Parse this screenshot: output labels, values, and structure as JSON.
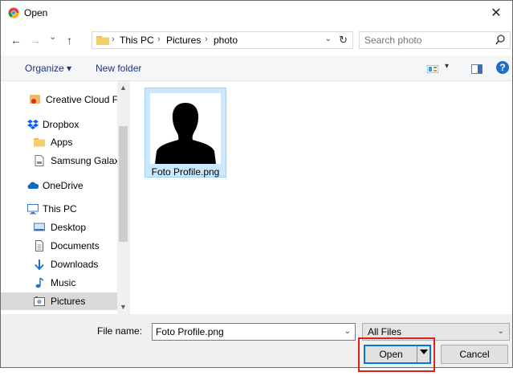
{
  "window": {
    "title": "Open",
    "close_glyph": "✕"
  },
  "nav": {
    "back": "←",
    "forward": "→",
    "recent": "⌄",
    "up": "↑",
    "breadcrumb": [
      "This PC",
      "Pictures",
      "photo"
    ],
    "separator": "›",
    "address_dropdown": "⌄",
    "refresh": "↻",
    "search_placeholder": "Search photo"
  },
  "toolbar": {
    "organize": "Organize ▾",
    "new_folder": "New folder",
    "view_dropdown": "▾",
    "help": "?"
  },
  "sidebar": {
    "items": [
      {
        "label": "Creative Cloud Fil",
        "icon": "creative-cloud-icon"
      },
      {
        "label": "Dropbox",
        "icon": "dropbox-icon"
      },
      {
        "label": "Apps",
        "icon": "folder-icon"
      },
      {
        "label": "Samsung Galaxy",
        "icon": "file-icon"
      },
      {
        "label": "OneDrive",
        "icon": "onedrive-icon"
      },
      {
        "label": "This PC",
        "icon": "computer-icon"
      },
      {
        "label": "Desktop",
        "icon": "desktop-icon"
      },
      {
        "label": "Documents",
        "icon": "documents-icon"
      },
      {
        "label": "Downloads",
        "icon": "downloads-icon"
      },
      {
        "label": "Music",
        "icon": "music-icon"
      },
      {
        "label": "Pictures",
        "icon": "pictures-icon",
        "selected": true
      }
    ],
    "scroll_up": "▲",
    "scroll_down": "▼"
  },
  "files": [
    {
      "name": "Foto Profile.png",
      "icon": "person-silhouette-icon",
      "selected": true
    }
  ],
  "bottom": {
    "file_name_label": "File name:",
    "file_name_value": "Foto Profile.png",
    "file_name_dropdown": "⌄",
    "filter": "All Files",
    "filter_dropdown": "⌄",
    "open": "Open",
    "cancel": "Cancel"
  },
  "colors": {
    "selection": "#cce8ff",
    "accent": "#0078d7",
    "highlight": "#e0201d",
    "link": "#1e3287"
  }
}
